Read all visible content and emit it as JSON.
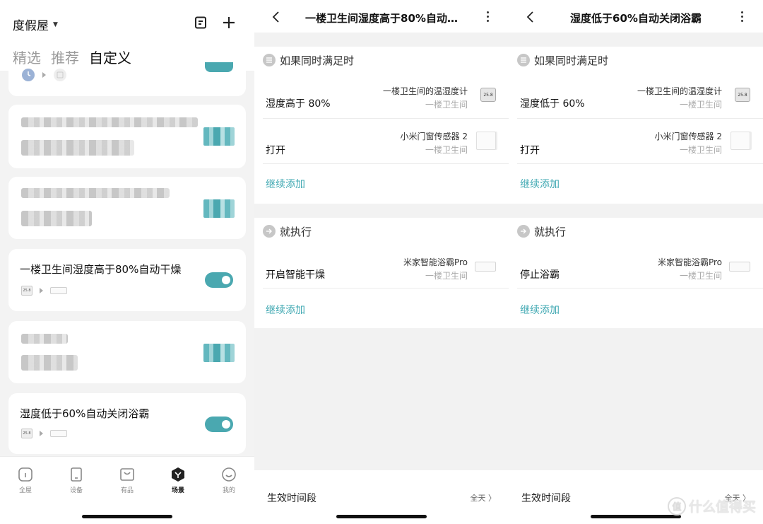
{
  "home": {
    "name": "度假屋",
    "tabs": [
      "精选",
      "推荐",
      "自定义"
    ],
    "active_tab": 2,
    "scenes": [
      {
        "name": "一楼卫生间湿度高于80%自动干燥",
        "enabled": true
      },
      {
        "name": "湿度低于60%自动关闭浴霸",
        "enabled": true
      }
    ],
    "nav": [
      {
        "label": "全屋",
        "icon": "home-icon"
      },
      {
        "label": "设备",
        "icon": "device-icon"
      },
      {
        "label": "有品",
        "icon": "shop-icon"
      },
      {
        "label": "场景",
        "icon": "scene-icon",
        "active": true
      },
      {
        "label": "我的",
        "icon": "profile-icon"
      }
    ]
  },
  "detail1": {
    "title": "一楼卫生间湿度高于80%自动…",
    "if_header": "如果同时满足时",
    "conditions": [
      {
        "label": "湿度高于 80%",
        "device": "一楼卫生间的温湿度计",
        "room": "一楼卫生间",
        "thumb": "thermo-hygrometer-icon"
      },
      {
        "label": "打开",
        "device": "小米门窗传感器 2",
        "room": "一楼卫生间",
        "thumb": "door-sensor-icon"
      }
    ],
    "add_condition": "继续添加",
    "then_header": "就执行",
    "actions": [
      {
        "label": "开启智能干燥",
        "device": "米家智能浴霸Pro",
        "room": "一楼卫生间",
        "thumb": "bath-heater-icon"
      }
    ],
    "add_action": "继续添加",
    "time_label": "生效时间段",
    "time_value": "全天"
  },
  "detail2": {
    "title": "湿度低于60%自动关闭浴霸",
    "if_header": "如果同时满足时",
    "conditions": [
      {
        "label": "湿度低于 60%",
        "device": "一楼卫生间的温湿度计",
        "room": "一楼卫生间",
        "thumb": "thermo-hygrometer-icon"
      },
      {
        "label": "打开",
        "device": "小米门窗传感器 2",
        "room": "一楼卫生间",
        "thumb": "door-sensor-icon"
      }
    ],
    "add_condition": "继续添加",
    "then_header": "就执行",
    "actions": [
      {
        "label": "停止浴霸",
        "device": "米家智能浴霸Pro",
        "room": "一楼卫生间",
        "thumb": "bath-heater-icon"
      }
    ],
    "add_action": "继续添加",
    "time_label": "生效时间段",
    "time_value": "全天"
  },
  "watermark": "什么值得买",
  "colors": {
    "accent": "#4aa8b0",
    "link": "#3fa8b2",
    "page_bg": "#f2f2f2"
  }
}
